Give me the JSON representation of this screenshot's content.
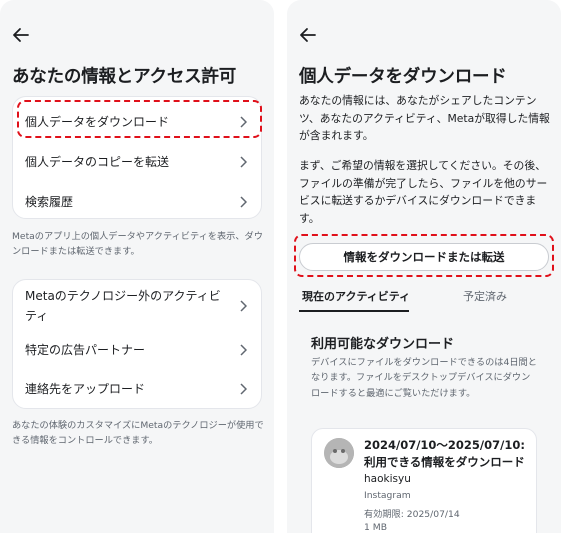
{
  "left": {
    "title": "あなたの情報とアクセス許可",
    "group1": [
      {
        "label": "個人データをダウンロード"
      },
      {
        "label": "個人データのコピーを転送"
      },
      {
        "label": "検索履歴"
      }
    ],
    "group1_desc": "Metaのアプリ上の個人データやアクティビティを表示、ダウンロードまたは転送できます。",
    "group2": [
      {
        "label": "Metaのテクノロジー外のアクティビティ"
      },
      {
        "label": "特定の広告パートナー"
      },
      {
        "label": "連絡先をアップロード"
      }
    ],
    "group2_desc": "あなたの体験のカスタマイズにMetaのテクノロジーが使用できる情報をコントロールできます。"
  },
  "right": {
    "title": "個人データをダウンロード",
    "intro": "あなたの情報には、あなたがシェアしたコンテンツ、あなたのアクティビティ、Metaが取得した情報が含まれます。",
    "instructions": "まず、ご希望の情報を選択してください。その後、ファイルの準備が完了したら、ファイルを他のサービスに転送するかデバイスにダウンロードできます。",
    "button_label": "情報をダウンロードまたは転送",
    "tabs": [
      {
        "label": "現在のアクティビティ",
        "active": true
      },
      {
        "label": "予定済み",
        "active": false
      }
    ],
    "downloads": {
      "heading": "利用可能なダウンロード",
      "description": "デバイスにファイルをダウンロードできるのは4日間となります。ファイルをデスクトップデバイスにダウンロードすると最適にご覧いただけます。",
      "item": {
        "title": "2024/07/10〜2025/07/10: 利用できる情報をダウンロード",
        "username": "haokisyu",
        "platform": "Instagram",
        "expiry": "有効期限: 2025/07/14",
        "size": "1 MB"
      }
    }
  },
  "colors": {
    "highlight": "#e0101a",
    "panel_bg": "#f5f6f7",
    "card_bg": "#ffffff",
    "text": "#1c1e21",
    "muted": "#606770"
  }
}
